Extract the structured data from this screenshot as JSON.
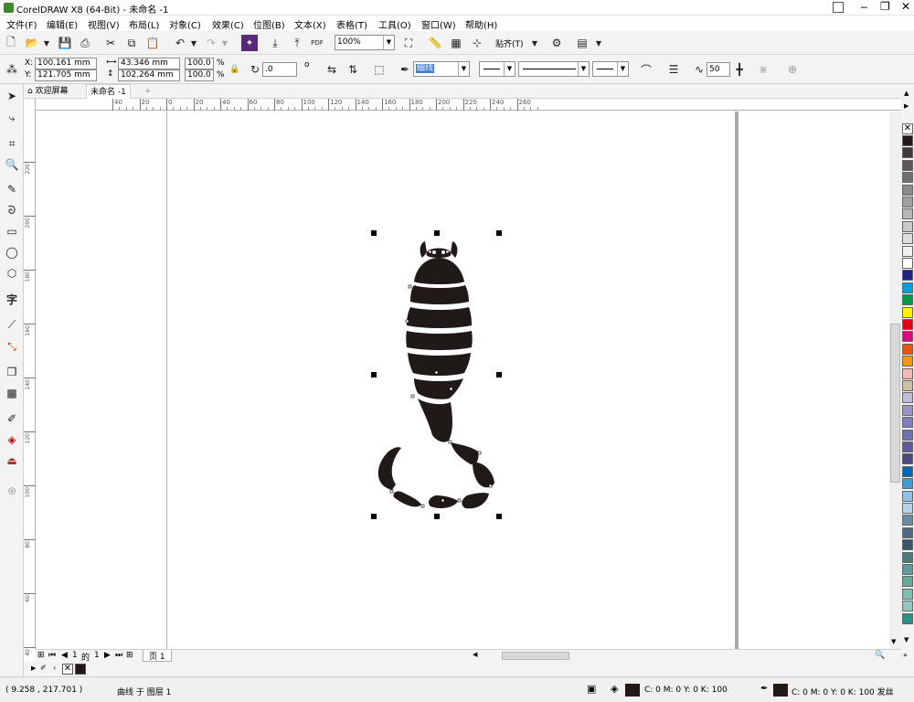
{
  "window": {
    "title": "CorelDRAW X8 (64-Bit) - 未命名 -1"
  },
  "menu": [
    "文件(F)",
    "编辑(E)",
    "视图(V)",
    "布局(L)",
    "对象(C)",
    "效果(C)",
    "位图(B)",
    "文本(X)",
    "表格(T)",
    "工具(O)",
    "窗口(W)",
    "帮助(H)"
  ],
  "toolbar": {
    "zoom": "100%",
    "snap": "贴齐(T)",
    "pdf": "PDF"
  },
  "properties": {
    "x_label": "X:",
    "x": "100.161 mm",
    "y_label": "Y:",
    "y": "121.705 mm",
    "width": "43.346 mm",
    "height": "102.264 mm",
    "scale_x": "100.0",
    "scale_y": "100.0",
    "percent": "%",
    "rotation": ".0",
    "degree": "o",
    "outline_width": "细线",
    "smoothing": "50"
  },
  "tabs": {
    "welcome": "欢迎屏幕",
    "doc": "未命名 -1"
  },
  "ruler": {
    "h": [
      "40",
      "20",
      "0",
      "20",
      "40",
      "60",
      "80",
      "100",
      "120",
      "140",
      "160",
      "180",
      "200",
      "220",
      "240",
      "260"
    ],
    "v": [
      "220",
      "200",
      "180",
      "160",
      "140",
      "120",
      "100",
      "80",
      "60",
      "40"
    ]
  },
  "pagenav": {
    "cur": "1",
    "of": "的",
    "total": "1",
    "page_tab": "页 1"
  },
  "status": {
    "coords": "( 9.258 , 217.701 )",
    "object": "曲线 于 图层 1",
    "fill": "C: 0 M: 0 Y: 0 K: 100",
    "outline": "C: 0 M: 0 Y: 0 K: 100 发丝"
  },
  "colors": {
    "ink": "#1f1a17",
    "accent": "#0078d7"
  },
  "palette": [
    "#231815",
    "#3e3a39",
    "#595757",
    "#727171",
    "#898989",
    "#9fa0a0",
    "#b5b5b6",
    "#c9caca",
    "#dcdddd",
    "#efefef",
    "#ffffff",
    "#1d2088",
    "#00a0e9",
    "#009944",
    "#fff100",
    "#e60012",
    "#e4007f",
    "#e95513",
    "#f39800",
    "#f8b9b7",
    "#d1c0a5",
    "#bfb8d6",
    "#9b93c6",
    "#7f7fc0",
    "#6f6fb4",
    "#5c5c99",
    "#4a4a80",
    "#0068b7",
    "#3e9bd4",
    "#8ec1e4",
    "#b3d4e8",
    "#6a8ba5",
    "#4d6b82",
    "#385666",
    "#4b7b7c",
    "#5e9c9c",
    "#66a99a",
    "#7cc1b0",
    "#91c7be",
    "#2f8f8f"
  ]
}
